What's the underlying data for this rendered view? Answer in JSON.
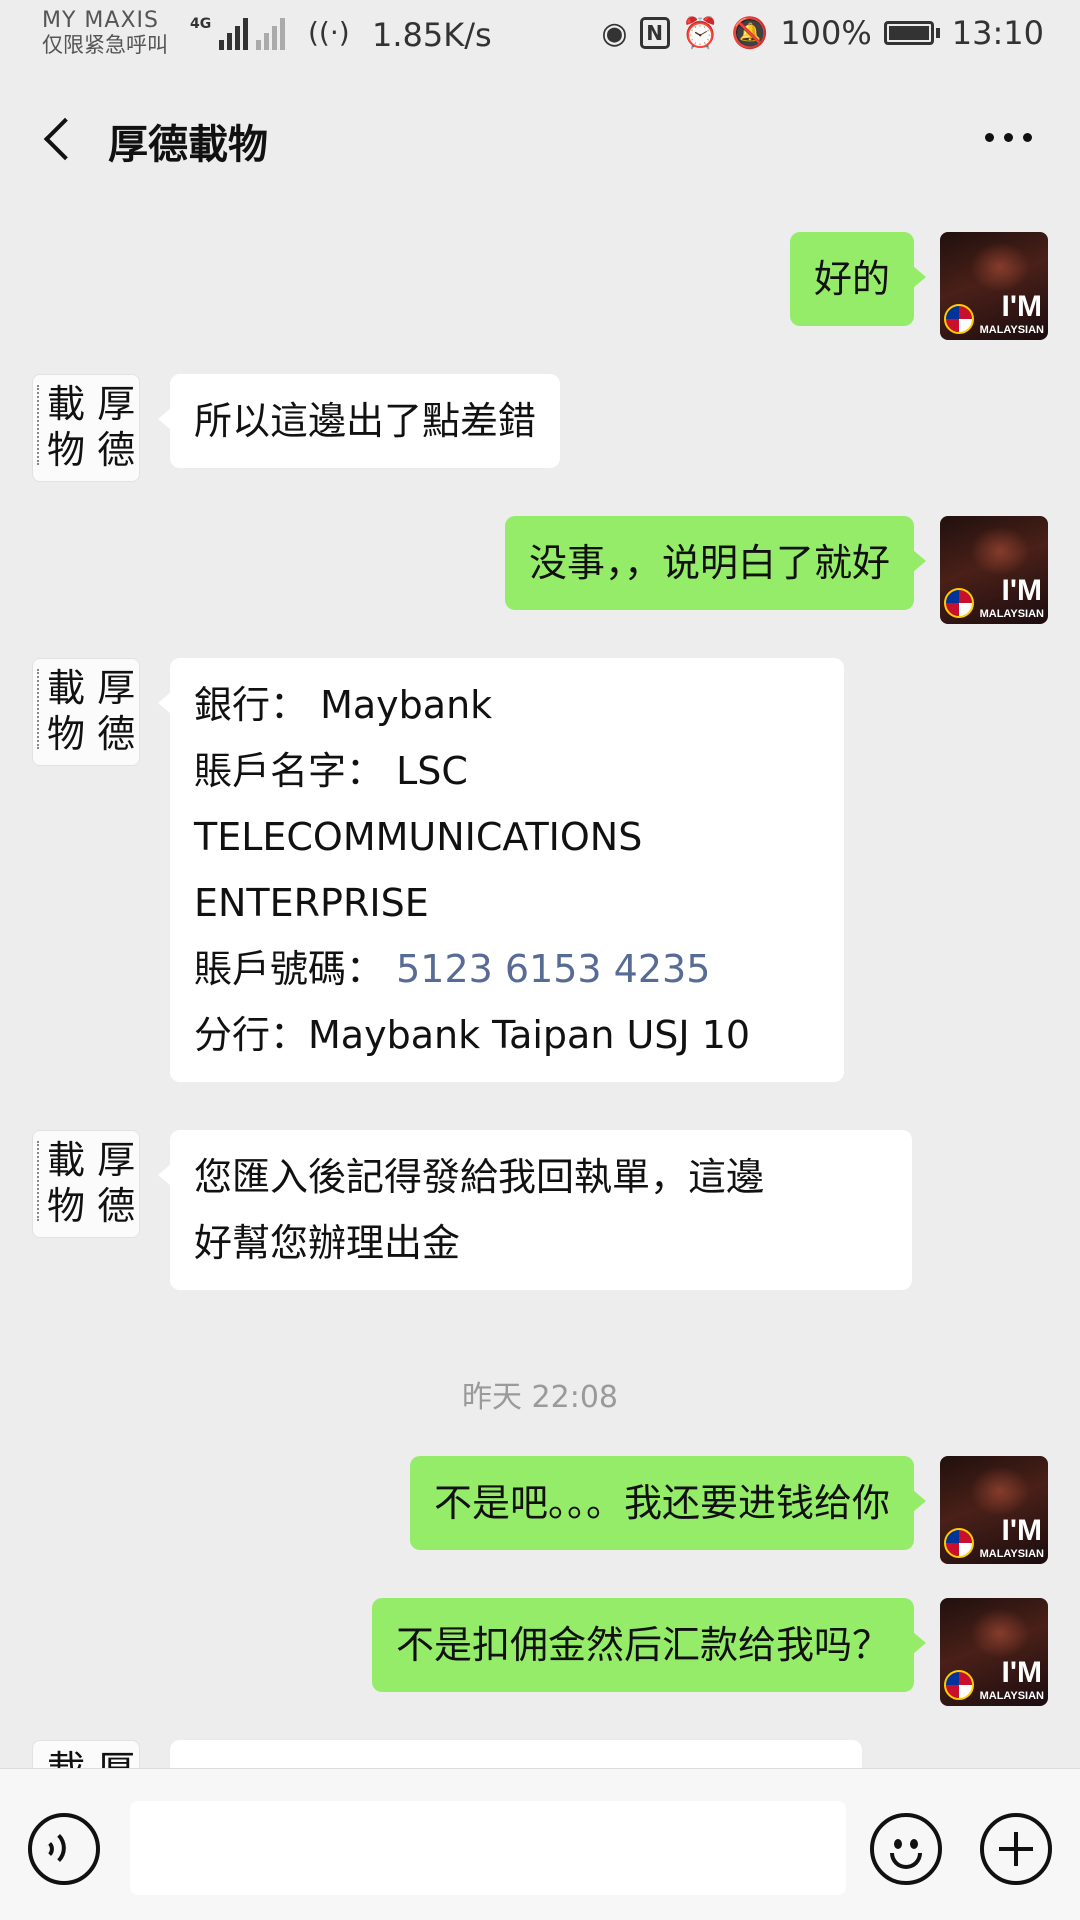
{
  "status_bar": {
    "carrier": "MY MAXIS",
    "emergency": "仅限紧急呼叫",
    "network": "4G",
    "wifi_label": "1",
    "net_speed": "1.85K/s",
    "battery": "100%",
    "battery_level": 1.0,
    "time": "13:10",
    "icons": [
      "signal-icon",
      "wifi-icon",
      "eye-icon",
      "nfc-icon",
      "alarm-icon",
      "mute-icon",
      "battery-icon"
    ]
  },
  "header": {
    "title": "厚德載物",
    "back_icon": "chevron-left-icon",
    "more_icon": "more-dots-icon"
  },
  "contact": {
    "avatar_text": "厚德載物",
    "my_avatar_text": "I'M",
    "my_avatar_sub": "MALAYSIAN"
  },
  "messages": [
    {
      "from": "me",
      "text": "好的"
    },
    {
      "from": "them",
      "text": "所以這邊出了點差錯"
    },
    {
      "from": "me",
      "text": "没事，，说明白了就好"
    },
    {
      "from": "them",
      "bank_label": "銀行：",
      "bank_value": "Maybank",
      "acct_name_label": "賬戶名字：",
      "acct_name_value_1": "LSC",
      "acct_name_value_2": "TELECOMMUNICATIONS",
      "acct_name_value_3": "ENTERPRISE",
      "acct_no_label": "賬戶號碼：",
      "acct_no_value": "5123 6153 4235",
      "branch_label": "分行：",
      "branch_value": "Maybank Taipan USJ 10"
    },
    {
      "from": "them",
      "text_1": "您匯入後記得發給我回執單，這邊",
      "text_2": "好幫您辦理出金"
    },
    {
      "from": "me",
      "text": "不是吧。。。我还要进钱给你"
    },
    {
      "from": "me",
      "text": "不是扣佣金然后汇款给我吗？"
    }
  ],
  "timestamp": "昨天 22:08",
  "input_bar": {
    "voice_icon": "voice-icon",
    "emoji_icon": "emoji-icon",
    "plus_icon": "plus-icon",
    "input_value": ""
  }
}
